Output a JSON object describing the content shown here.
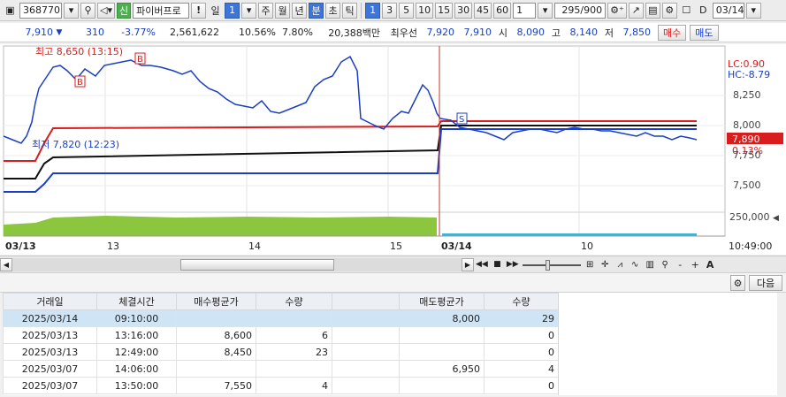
{
  "toolbar": {
    "stock_code": "368770",
    "tag": "신",
    "stock_name": "파이버프로",
    "exclaim": "!",
    "period_label": "일",
    "period_value": "1",
    "periods": [
      "주",
      "월",
      "년",
      "분",
      "초",
      "틱"
    ],
    "active_period": "분",
    "minutes": [
      "1",
      "3",
      "5",
      "10",
      "15",
      "30",
      "45",
      "60"
    ],
    "active_minute": "1",
    "count_select": "1",
    "data_count": "295",
    "data_max": "/900",
    "date_check_label": "D",
    "date_value": "03/14"
  },
  "info": {
    "price": "7,910",
    "change": "310",
    "change_pct": "-3.77%",
    "volume": "2,561,622",
    "turnover_pct": "10.56%",
    "rate": "7.80%",
    "amount": "20,388백만",
    "best_label": "최우선",
    "best_ask": "7,920",
    "best_bid": "7,910",
    "open_label": "시",
    "open": "8,090",
    "high_label": "고",
    "high": "8,140",
    "low_label": "저",
    "low": "7,850",
    "buy_label": "매수",
    "sell_label": "매도"
  },
  "chart": {
    "high_annotation": "최고 8,650 (13:15)",
    "low_annotation": "최저 7,820 (12:23)",
    "lc_label": "LC:0.90",
    "hc_label": "HC:-8.79",
    "price_ticks": [
      "8,250",
      "8,000",
      "7,750",
      "7,500"
    ],
    "volume_tick": "250,000",
    "current_price_tag": "7,890",
    "current_pct_tag": "0.13%",
    "date_labels": [
      "03/13",
      "13",
      "14",
      "15",
      "03/14",
      "10"
    ],
    "time_label": "10:49:00",
    "marker_b": "B",
    "marker_s": "S",
    "colors": {
      "up": "#d81d1d",
      "down": "#1a3fc4",
      "volume": "#8cc63f",
      "cursor": "#c0392b"
    }
  },
  "scroll": {
    "zoom_minus": "-",
    "zoom_plus": "+",
    "font_label": "A"
  },
  "grid": {
    "next_label": "다음",
    "columns": [
      "거래일",
      "체결시간",
      "매수평균가",
      "수량",
      "",
      "매도평균가",
      "수량"
    ],
    "rows": [
      [
        "2025/03/14",
        "09:10:00",
        "",
        "",
        "",
        "8,000",
        "29"
      ],
      [
        "2025/03/13",
        "13:16:00",
        "8,600",
        "6",
        "",
        "",
        "0"
      ],
      [
        "2025/03/13",
        "12:49:00",
        "8,450",
        "23",
        "",
        "",
        "0"
      ],
      [
        "2025/03/07",
        "14:06:00",
        "",
        "",
        "",
        "6,950",
        "4"
      ],
      [
        "2025/03/07",
        "13:50:00",
        "7,550",
        "4",
        "",
        "",
        "0"
      ]
    ]
  }
}
